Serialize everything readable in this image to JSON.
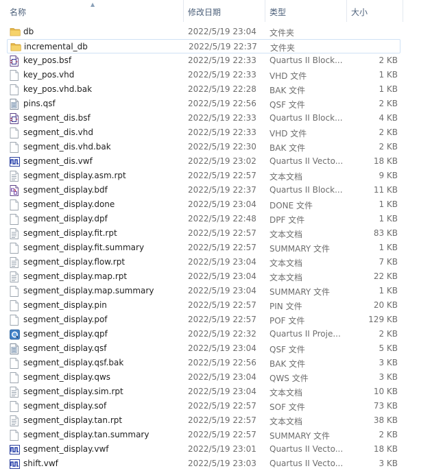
{
  "columns": {
    "name": "名称",
    "date": "修改日期",
    "type": "类型",
    "size": "大小"
  },
  "files": [
    {
      "name": "db",
      "date": "2022/5/19 23:04",
      "type": "文件夹",
      "size": "",
      "icon": "folder-icon"
    },
    {
      "name": "incremental_db",
      "date": "2022/5/19 22:37",
      "type": "文件夹",
      "size": "",
      "icon": "folder-icon",
      "selected": true
    },
    {
      "name": "key_pos.bsf",
      "date": "2022/5/19 22:33",
      "type": "Quartus II Block...",
      "size": "2 KB",
      "icon": "block-symbol-file-icon"
    },
    {
      "name": "key_pos.vhd",
      "date": "2022/5/19 22:33",
      "type": "VHD 文件",
      "size": "1 KB",
      "icon": "blank-file-icon"
    },
    {
      "name": "key_pos.vhd.bak",
      "date": "2022/5/19 22:28",
      "type": "BAK 文件",
      "size": "1 KB",
      "icon": "blank-file-icon"
    },
    {
      "name": "pins.qsf",
      "date": "2022/5/19 22:56",
      "type": "QSF 文件",
      "size": "2 KB",
      "icon": "settings-file-icon"
    },
    {
      "name": "segment_dis.bsf",
      "date": "2022/5/19 22:33",
      "type": "Quartus II Block...",
      "size": "4 KB",
      "icon": "block-symbol-file-icon"
    },
    {
      "name": "segment_dis.vhd",
      "date": "2022/5/19 22:33",
      "type": "VHD 文件",
      "size": "2 KB",
      "icon": "blank-file-icon"
    },
    {
      "name": "segment_dis.vhd.bak",
      "date": "2022/5/19 22:30",
      "type": "BAK 文件",
      "size": "2 KB",
      "icon": "blank-file-icon"
    },
    {
      "name": "segment_dis.vwf",
      "date": "2022/5/19 23:02",
      "type": "Quartus II Vecto...",
      "size": "18 KB",
      "icon": "waveform-file-icon"
    },
    {
      "name": "segment_display.asm.rpt",
      "date": "2022/5/19 22:57",
      "type": "文本文档",
      "size": "9 KB",
      "icon": "text-file-icon"
    },
    {
      "name": "segment_display.bdf",
      "date": "2022/5/19 22:37",
      "type": "Quartus II Block...",
      "size": "11 KB",
      "icon": "block-diagram-file-icon"
    },
    {
      "name": "segment_display.done",
      "date": "2022/5/19 23:04",
      "type": "DONE 文件",
      "size": "1 KB",
      "icon": "blank-file-icon"
    },
    {
      "name": "segment_display.dpf",
      "date": "2022/5/19 22:48",
      "type": "DPF 文件",
      "size": "1 KB",
      "icon": "blank-file-icon"
    },
    {
      "name": "segment_display.fit.rpt",
      "date": "2022/5/19 22:57",
      "type": "文本文档",
      "size": "83 KB",
      "icon": "text-file-icon"
    },
    {
      "name": "segment_display.fit.summary",
      "date": "2022/5/19 22:57",
      "type": "SUMMARY 文件",
      "size": "1 KB",
      "icon": "blank-file-icon"
    },
    {
      "name": "segment_display.flow.rpt",
      "date": "2022/5/19 23:04",
      "type": "文本文档",
      "size": "7 KB",
      "icon": "text-file-icon"
    },
    {
      "name": "segment_display.map.rpt",
      "date": "2022/5/19 23:04",
      "type": "文本文档",
      "size": "22 KB",
      "icon": "text-file-icon"
    },
    {
      "name": "segment_display.map.summary",
      "date": "2022/5/19 23:04",
      "type": "SUMMARY 文件",
      "size": "1 KB",
      "icon": "blank-file-icon"
    },
    {
      "name": "segment_display.pin",
      "date": "2022/5/19 22:57",
      "type": "PIN 文件",
      "size": "20 KB",
      "icon": "blank-file-icon"
    },
    {
      "name": "segment_display.pof",
      "date": "2022/5/19 22:57",
      "type": "POF 文件",
      "size": "129 KB",
      "icon": "blank-file-icon"
    },
    {
      "name": "segment_display.qpf",
      "date": "2022/5/19 22:32",
      "type": "Quartus II Proje...",
      "size": "2 KB",
      "icon": "project-file-icon"
    },
    {
      "name": "segment_display.qsf",
      "date": "2022/5/19 23:04",
      "type": "QSF 文件",
      "size": "5 KB",
      "icon": "settings-file-icon"
    },
    {
      "name": "segment_display.qsf.bak",
      "date": "2022/5/19 22:56",
      "type": "BAK 文件",
      "size": "3 KB",
      "icon": "blank-file-icon"
    },
    {
      "name": "segment_display.qws",
      "date": "2022/5/19 23:04",
      "type": "QWS 文件",
      "size": "3 KB",
      "icon": "blank-file-icon"
    },
    {
      "name": "segment_display.sim.rpt",
      "date": "2022/5/19 23:04",
      "type": "文本文档",
      "size": "10 KB",
      "icon": "text-file-icon"
    },
    {
      "name": "segment_display.sof",
      "date": "2022/5/19 22:57",
      "type": "SOF 文件",
      "size": "73 KB",
      "icon": "blank-file-icon"
    },
    {
      "name": "segment_display.tan.rpt",
      "date": "2022/5/19 22:57",
      "type": "文本文档",
      "size": "38 KB",
      "icon": "text-file-icon"
    },
    {
      "name": "segment_display.tan.summary",
      "date": "2022/5/19 22:57",
      "type": "SUMMARY 文件",
      "size": "2 KB",
      "icon": "blank-file-icon"
    },
    {
      "name": "segment_display.vwf",
      "date": "2022/5/19 23:01",
      "type": "Quartus II Vecto...",
      "size": "18 KB",
      "icon": "waveform-file-icon"
    },
    {
      "name": "shift.vwf",
      "date": "2022/5/19 23:03",
      "type": "Quartus II Vecto...",
      "size": "3 KB",
      "icon": "waveform-file-icon"
    }
  ]
}
